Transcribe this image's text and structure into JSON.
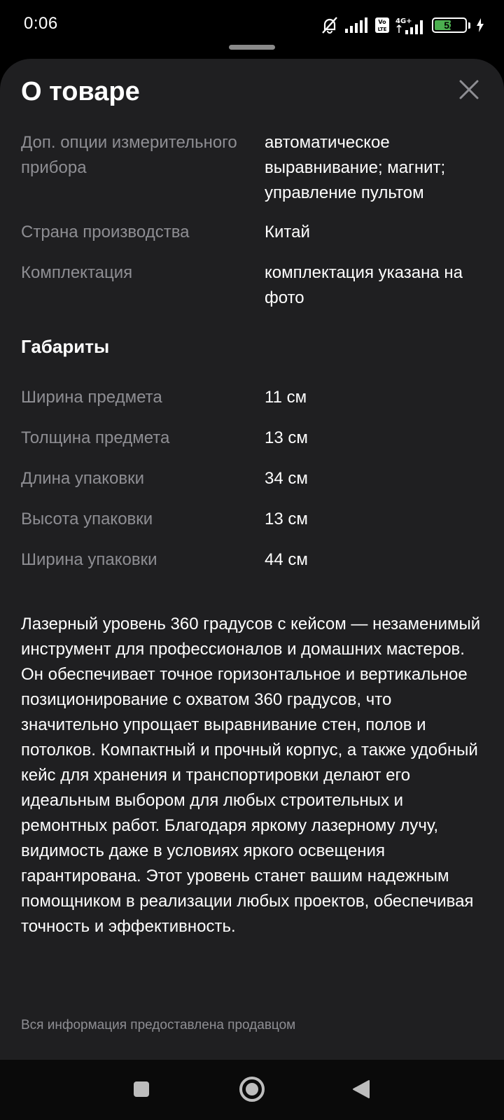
{
  "status_bar": {
    "time": "0:06",
    "battery_level": "52",
    "network": "4G+",
    "volte": "Vo LTE"
  },
  "sheet": {
    "title": "О товаре",
    "close_icon": "close-icon"
  },
  "attributes": [
    {
      "label": "Доп. опции измерительного прибора",
      "value": "автоматическое выравнивание; магнит; управление пультом"
    },
    {
      "label": "Страна производства",
      "value": "Китай"
    },
    {
      "label": "Комплектация",
      "value": "комплектация указана на фото"
    }
  ],
  "dimensions": {
    "title": "Габариты",
    "items": [
      {
        "label": "Ширина предмета",
        "value": "11 см"
      },
      {
        "label": "Толщина предмета",
        "value": "13 см"
      },
      {
        "label": "Длина упаковки",
        "value": "34 см"
      },
      {
        "label": "Высота упаковки",
        "value": "13 см"
      },
      {
        "label": "Ширина упаковки",
        "value": "44 см"
      }
    ]
  },
  "description": "Лазерный уровень 360 градусов с кейсом — незаменимый инструмент для профессионалов и домашних мастеров. Он обеспечивает точное горизонтальное и вертикальное позиционирование с охватом 360 градусов, что значительно упрощает выравнивание стен, полов и потолков. Компактный и прочный корпус, а также удобный кейс для хранения и транспортировки делают его идеальным выбором для любых строительных и ремонтных работ. Благодаря яркому лазерному лучу, видимость даже в условиях яркого освещения гарантирована. Этот уровень станет вашим надежным помощником в реализации любых проектов, обеспечивая точность и эффективность.",
  "footnote": "Вся информация предоставлена продавцом",
  "nav": {
    "recents_icon": "square-icon",
    "home_icon": "circle-icon",
    "back_icon": "triangle-back-icon"
  },
  "colors": {
    "sheet_bg": "#1f1f21",
    "label": "#8e8e93",
    "text": "#ffffff",
    "battery": "#4caf50"
  }
}
